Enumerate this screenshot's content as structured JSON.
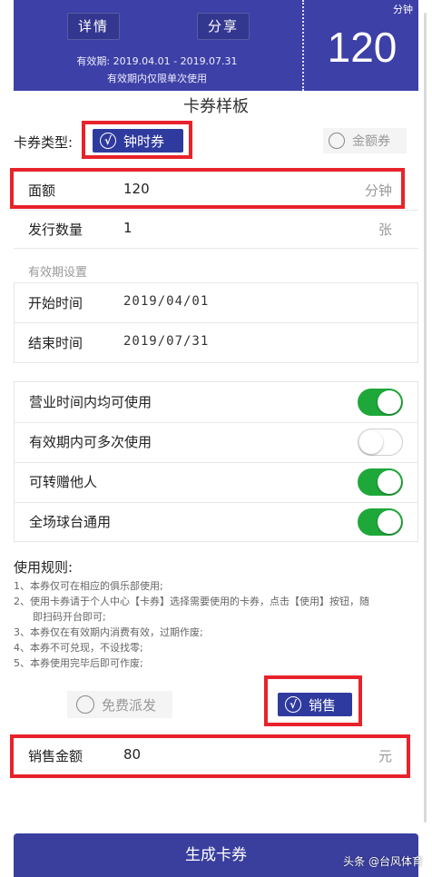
{
  "ticket": {
    "detail_button": "详情",
    "share_button": "分享",
    "validity_period": "有效期: 2019.04.01 - 2019.07.31",
    "validity_note": "有效期内仅限单次使用",
    "unit": "分钟",
    "value": "120",
    "colors": {
      "background": "#3d40a6"
    }
  },
  "page_title": "卡券样板",
  "card_type": {
    "label": "卡券类型:",
    "options": [
      {
        "label": "钟时券",
        "selected": true
      },
      {
        "label": "金额券",
        "selected": false
      }
    ]
  },
  "denomination": {
    "label": "面额",
    "value": "120",
    "unit": "分钟"
  },
  "quantity": {
    "label": "发行数量",
    "value": "1",
    "unit": "张"
  },
  "validity_settings": {
    "section_label": "有效期设置",
    "start": {
      "label": "开始时间",
      "value": "2019/04/01"
    },
    "end": {
      "label": "结束时间",
      "value": "2019/07/31"
    }
  },
  "toggles": [
    {
      "label": "营业时间内均可使用",
      "on": true
    },
    {
      "label": "有效期内可多次使用",
      "on": false
    },
    {
      "label": "可转赠他人",
      "on": true
    },
    {
      "label": "全场球台通用",
      "on": true
    }
  ],
  "rules": {
    "title": "使用规则:",
    "items": [
      "1、本券仅可在相应的俱乐部使用;",
      "2、使用卡券请于个人中心【卡券】选择需要使用的卡券，点击【使用】按钮，随",
      "即扫码开台即可;",
      "3、本券仅在有效期内消费有效，过期作废;",
      "4、本券不可兑现，不设找零;",
      "5、本券使用完毕后即可作废;"
    ]
  },
  "distribution": {
    "options": [
      {
        "label": "免费派发",
        "selected": false
      },
      {
        "label": "销售",
        "selected": true
      }
    ]
  },
  "sale_amount": {
    "label": "销售金额",
    "value": "80",
    "unit": "元"
  },
  "generate_button": "生成卡券",
  "watermark": "头条 @台风体育",
  "colors": {
    "accent": "#3d40a6",
    "highlight": "#e8222b",
    "toggle_on": "#1fa83a"
  }
}
